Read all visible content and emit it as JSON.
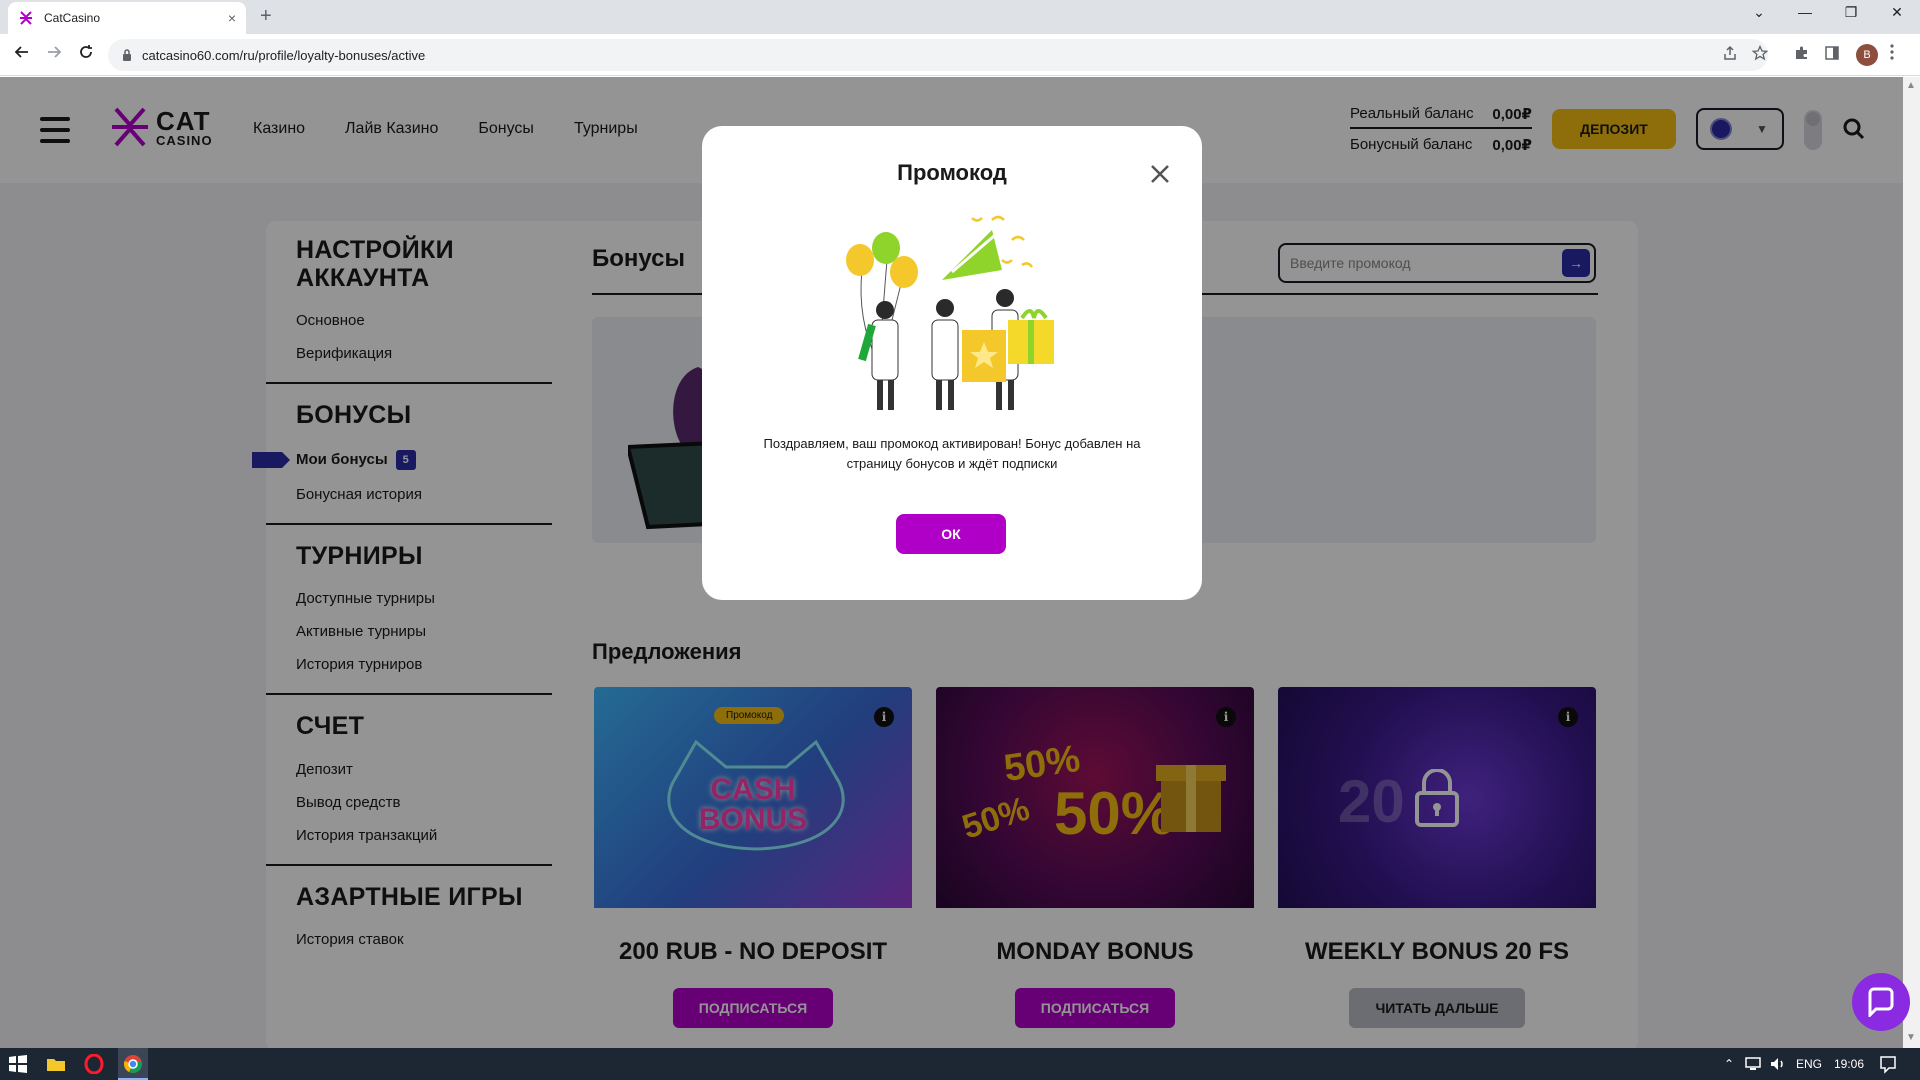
{
  "browser": {
    "tab_title": "CatCasino",
    "tab_close": "×",
    "new_tab": "+",
    "url": "catcasino60.com/ru/profile/loyalty-bonuses/active",
    "profile_initial": "B",
    "window_min": "—",
    "window_restore": "❐",
    "window_close": "✕",
    "tab_search": "⌄"
  },
  "header": {
    "logo_top": "CAT",
    "logo_bottom": "CASINO",
    "nav": [
      "Казино",
      "Лайв Казино",
      "Бонусы",
      "Турниры"
    ],
    "real_balance_label": "Реальный баланс",
    "real_balance_value": "0,00₽",
    "bonus_balance_label": "Бонусный баланс",
    "bonus_balance_value": "0,00₽",
    "deposit_label": "ДЕПОЗИТ"
  },
  "sidebar": {
    "sections": [
      {
        "title": "НАСТРОЙКИ АККАУНТА",
        "items": [
          "Основное",
          "Верификация"
        ]
      },
      {
        "title": "БОНУСЫ",
        "items": [
          "Мои бонусы",
          "Бонусная история"
        ]
      },
      {
        "title": "ТУРНИРЫ",
        "items": [
          "Доступные турниры",
          "Активные турниры",
          "История турниров"
        ]
      },
      {
        "title": "СЧЕТ",
        "items": [
          "Депозит",
          "Вывод средств",
          "История транзакций"
        ]
      },
      {
        "title": "АЗАРТНЫЕ ИГРЫ",
        "items": [
          "История ставок"
        ]
      }
    ],
    "my_bonuses_badge": "5"
  },
  "main": {
    "title": "Бонусы",
    "promo_placeholder": "Введите промокод",
    "promo_go": "→",
    "offers_title": "Предложения",
    "offers": [
      {
        "tag": "Промокод",
        "art_line1": "CASH",
        "art_line2": "BONUS",
        "title": "200 RUB - NO DEPOSIT",
        "button": "ПОДПИСАТЬСЯ",
        "info": "i"
      },
      {
        "art_a": "50%",
        "art_b": "50%",
        "art_c": "50%",
        "title": "MONDAY BONUS",
        "button": "ПОДПИСАТЬСЯ",
        "info": "i"
      },
      {
        "art_text": "20",
        "title": "WEEKLY BONUS 20 FS",
        "button": "ЧИТАТЬ ДАЛЬШЕ",
        "info": "i"
      }
    ]
  },
  "modal": {
    "title": "Промокод",
    "message": "Поздравляем, ваш промокод активирован! Бонус добавлен на страницу бонусов и ждёт подписки",
    "ok_label": "ОК"
  },
  "taskbar": {
    "lang": "ENG",
    "time": "19:06"
  },
  "colors": {
    "accent_purple": "#b000c8",
    "accent_yellow": "#f4bd12",
    "accent_blue": "#2c2ca8"
  }
}
